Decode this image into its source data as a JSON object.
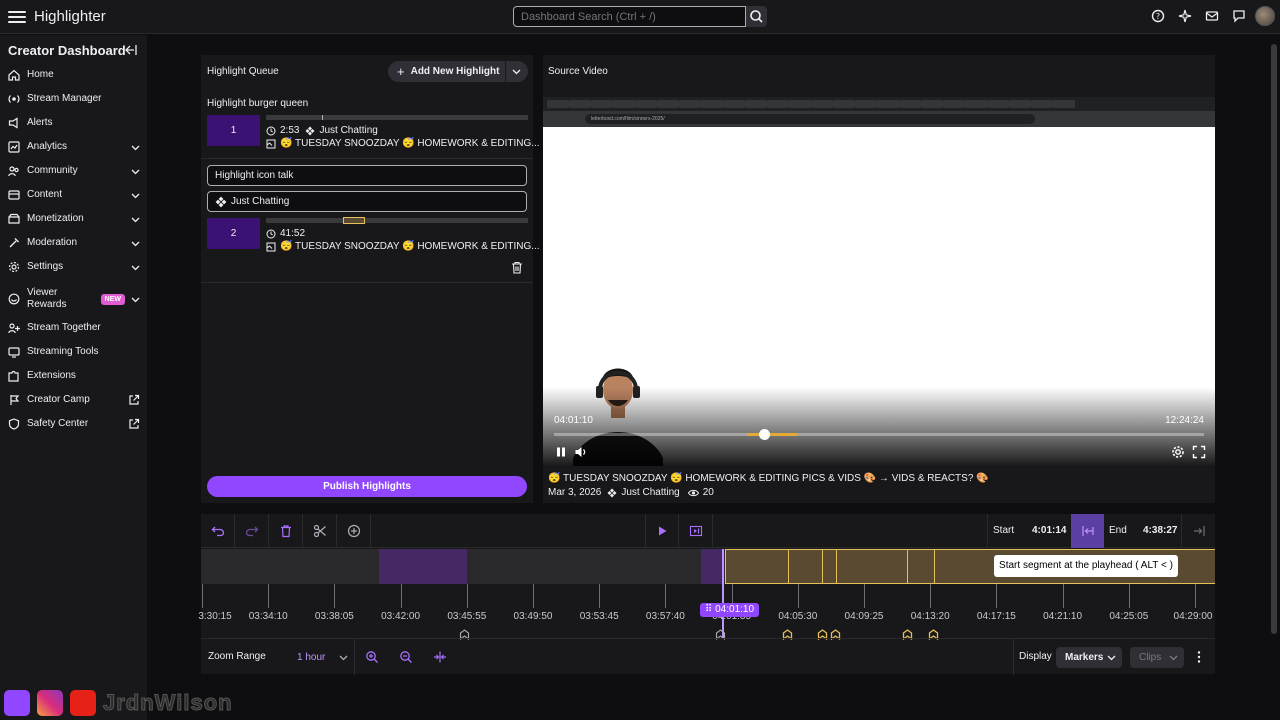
{
  "app": {
    "title": "Highlighter"
  },
  "search": {
    "placeholder": "Dashboard Search (Ctrl + /)"
  },
  "sidebar": {
    "title": "Creator Dashboard",
    "items": [
      {
        "label": "Home",
        "icon": "home-icon",
        "expandable": false
      },
      {
        "label": "Stream Manager",
        "icon": "stream-manager-icon",
        "expandable": false
      },
      {
        "label": "Alerts",
        "icon": "alerts-icon",
        "expandable": false
      },
      {
        "label": "Analytics",
        "icon": "analytics-icon",
        "expandable": true
      },
      {
        "label": "Community",
        "icon": "community-icon",
        "expandable": true
      },
      {
        "label": "Content",
        "icon": "content-icon",
        "expandable": true
      },
      {
        "label": "Monetization",
        "icon": "monetization-icon",
        "expandable": true
      },
      {
        "label": "Moderation",
        "icon": "moderation-icon",
        "expandable": true
      },
      {
        "label": "Settings",
        "icon": "settings-icon",
        "expandable": true
      },
      {
        "label": "Viewer Rewards",
        "icon": "viewer-rewards-icon",
        "expandable": true,
        "badge": "NEW"
      },
      {
        "label": "Stream Together",
        "icon": "stream-together-icon",
        "expandable": false
      },
      {
        "label": "Streaming Tools",
        "icon": "streaming-tools-icon",
        "expandable": false
      },
      {
        "label": "Extensions",
        "icon": "extensions-icon",
        "expandable": false
      },
      {
        "label": "Creator Camp",
        "icon": "creator-camp-icon",
        "external": true
      },
      {
        "label": "Safety Center",
        "icon": "safety-center-icon",
        "external": true
      }
    ]
  },
  "queue": {
    "title": "Highlight Queue",
    "add_label": "Add New Highlight",
    "highlights": [
      {
        "name": "Highlight burger queen",
        "index": "1",
        "duration": "2:53",
        "category": "Just Chatting",
        "source": "😴 TUESDAY SNOOZDAY 😴 HOMEWORK & EDITING..."
      },
      {
        "name_value": "Highlight icon talk",
        "category_value": "Just Chatting",
        "index": "2",
        "duration": "41:52",
        "source": "😴 TUESDAY SNOOZDAY 😴 HOMEWORK & EDITING..."
      }
    ],
    "publish_label": "Publish Highlights"
  },
  "source_video": {
    "title": "Source Video",
    "current_time": "04:01:10",
    "total_time": "12:24:24",
    "browser_url": "letterboxd.com/film/sinners-2025/",
    "progress": 0.319,
    "stream_title": "😴 TUESDAY SNOOZDAY 😴 HOMEWORK & EDITING PICS & VIDS 🎨 → VIDS & REACTS? 🎨",
    "date": "Mar 3, 2026",
    "category": "Just Chatting",
    "views": "20"
  },
  "timeline": {
    "start_label": "Start",
    "start_value": "4:01:14",
    "end_label": "End",
    "end_value": "4:38:27",
    "tooltip": "Start segment at the playhead ( ALT < )",
    "ticks": [
      "3:30:15",
      "03:34:10",
      "03:38:05",
      "03:42:00",
      "03:45:55",
      "03:49:50",
      "03:53:45",
      "03:57:40",
      "04:01:35",
      "04:05:30",
      "04:09:25",
      "04:13:20",
      "04:17:15",
      "04:21:10",
      "04:25:05",
      "04:29:00"
    ],
    "playhead": "04:01:10",
    "zoom_label": "Zoom Range",
    "zoom_value": "1 hour",
    "display_label": "Display",
    "markers_label": "Markers",
    "clips_label": "Clips"
  },
  "watermark": {
    "text": "JrdnWilson"
  },
  "colors": {
    "accent": "#9147ff",
    "segment": "#e5c15a",
    "background": "#0e0e10",
    "panel": "#18181b"
  }
}
